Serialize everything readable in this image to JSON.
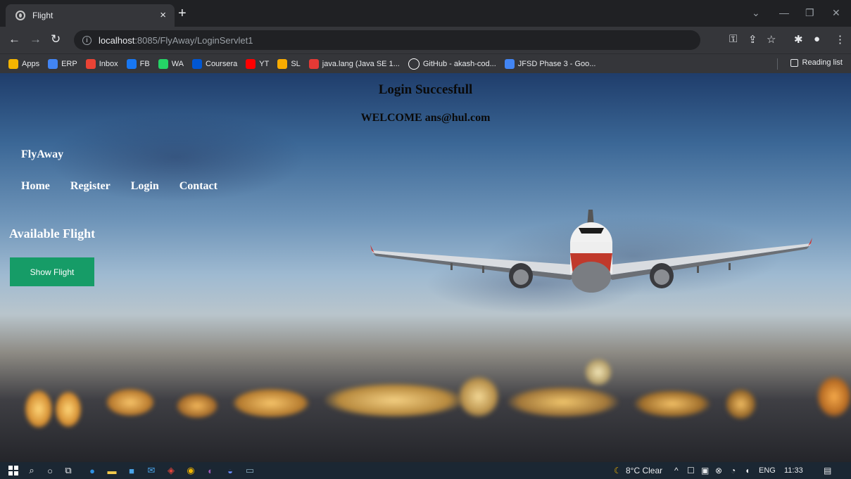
{
  "browser": {
    "tab_title": "Flight",
    "new_tab": "+",
    "close": "×",
    "url_host": "localhost",
    "url_path": ":8085/FlyAway/LoginServlet1",
    "bookmarks": [
      {
        "label": "Apps",
        "icon": "apps-grid-icon",
        "color": "#f4b400"
      },
      {
        "label": "ERP",
        "icon": "erp-icon",
        "color": "#4285f4"
      },
      {
        "label": "Inbox",
        "icon": "gmail-icon",
        "color": "#ea4335"
      },
      {
        "label": "FB",
        "icon": "facebook-icon",
        "color": "#1877f2"
      },
      {
        "label": "WA",
        "icon": "whatsapp-icon",
        "color": "#25d366"
      },
      {
        "label": "Coursera",
        "icon": "coursera-icon",
        "color": "#0056d2"
      },
      {
        "label": "YT",
        "icon": "youtube-icon",
        "color": "#ff0000"
      },
      {
        "label": "SL",
        "icon": "sl-icon",
        "color": "#f9ab00"
      },
      {
        "label": "java.lang (Java SE 1...",
        "icon": "oracle-icon",
        "color": "#e53935"
      },
      {
        "label": "GitHub - akash-cod...",
        "icon": "github-icon",
        "color": "#ffffff"
      },
      {
        "label": "JFSD Phase 3 - Goo...",
        "icon": "google-docs-icon",
        "color": "#4285f4"
      }
    ],
    "reading_list": "Reading list"
  },
  "page": {
    "login_message": "Login Succesfull",
    "welcome_message": "WELCOME ans@hul.com",
    "brand": "FlyAway",
    "nav": [
      "Home",
      "Register",
      "Login",
      "Contact"
    ],
    "section_title": "Available Flight",
    "show_button": "Show Flight"
  },
  "taskbar": {
    "weather": "8°C  Clear",
    "language": "ENG",
    "time": "11:33"
  },
  "colors": {
    "button": "#169c67",
    "chrome_dark": "#202124",
    "chrome_mid": "#35363a",
    "taskbar": "#1b2733"
  }
}
